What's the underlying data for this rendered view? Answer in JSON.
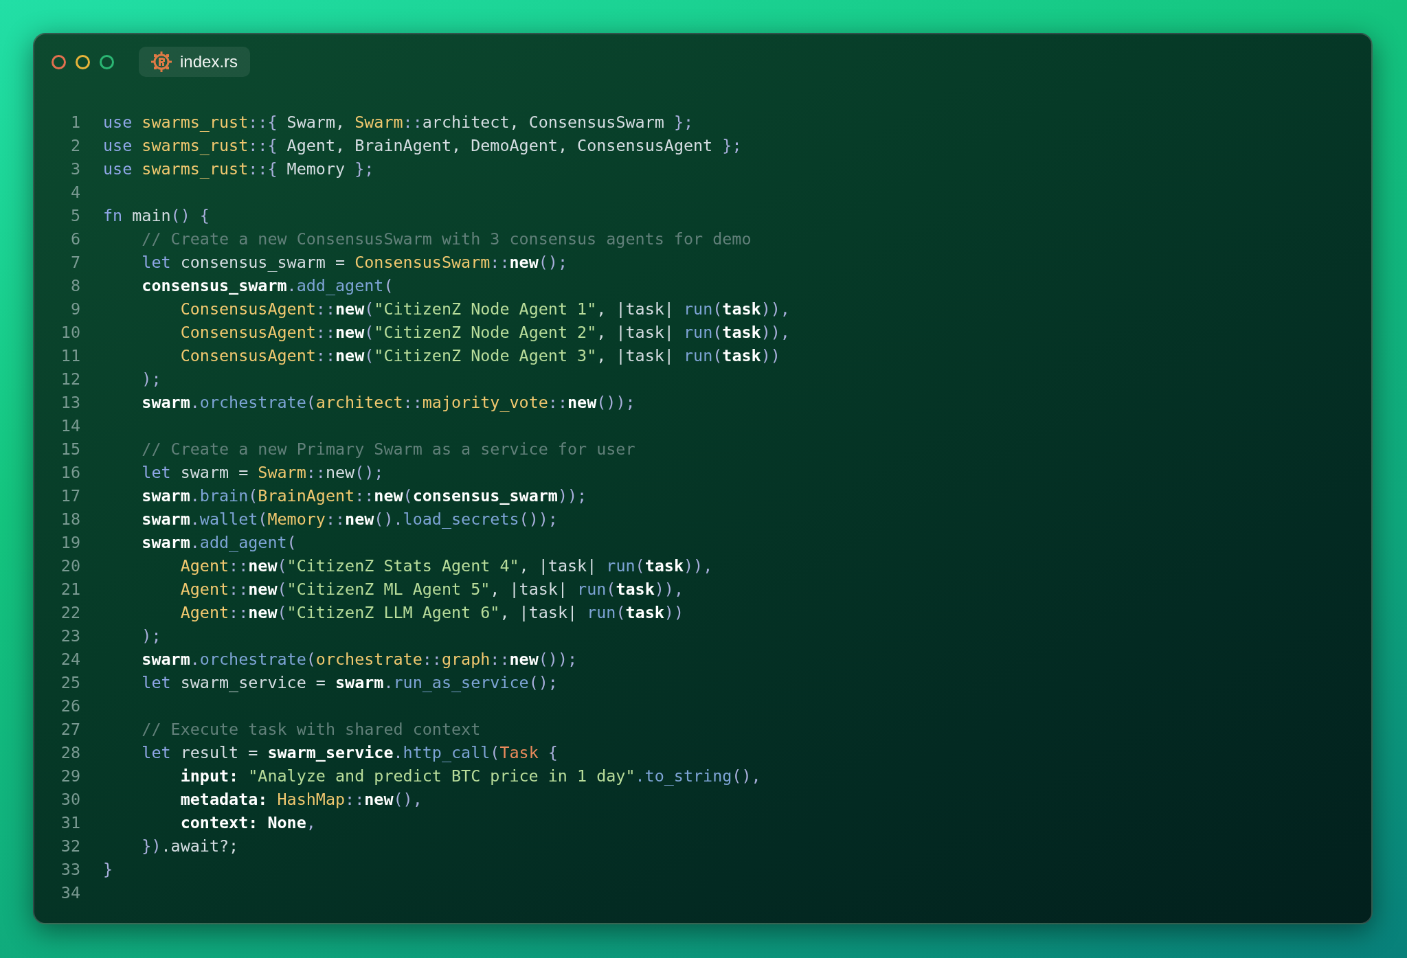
{
  "tab": {
    "title": "index.rs"
  },
  "lines": [
    {
      "number": "1",
      "tokens": [
        {
          "kind": "kw",
          "text": "use "
        },
        {
          "kind": "mod",
          "text": "swarms_rust"
        },
        {
          "kind": "punct",
          "text": "::{"
        },
        {
          "kind": "plain",
          "text": " Swarm, "
        },
        {
          "kind": "mod",
          "text": "Swarm"
        },
        {
          "kind": "punct",
          "text": "::"
        },
        {
          "kind": "plain",
          "text": "architect, ConsensusSwarm "
        },
        {
          "kind": "punct",
          "text": "};"
        }
      ]
    },
    {
      "number": "2",
      "tokens": [
        {
          "kind": "kw",
          "text": "use "
        },
        {
          "kind": "mod",
          "text": "swarms_rust"
        },
        {
          "kind": "punct",
          "text": "::{"
        },
        {
          "kind": "plain",
          "text": " Agent, BrainAgent, DemoAgent, ConsensusAgent "
        },
        {
          "kind": "punct",
          "text": "};"
        }
      ]
    },
    {
      "number": "3",
      "tokens": [
        {
          "kind": "kw",
          "text": "use "
        },
        {
          "kind": "mod",
          "text": "swarms_rust"
        },
        {
          "kind": "punct",
          "text": "::{"
        },
        {
          "kind": "plain",
          "text": " Memory "
        },
        {
          "kind": "punct",
          "text": "};"
        }
      ]
    },
    {
      "number": "4"
    },
    {
      "number": "5",
      "tokens": [
        {
          "kind": "kw",
          "text": "fn"
        },
        {
          "kind": "plain",
          "text": " main"
        },
        {
          "kind": "punct",
          "text": "() {"
        }
      ]
    },
    {
      "number": "6",
      "tokens": [
        {
          "kind": "comment",
          "text": "    // Create a new ConsensusSwarm with 3 consensus agents for demo"
        }
      ]
    },
    {
      "number": "7",
      "tokens": [
        {
          "kind": "kw",
          "text": "    let"
        },
        {
          "kind": "plain",
          "text": " consensus_swarm = "
        },
        {
          "kind": "mod",
          "text": "ConsensusSwarm"
        },
        {
          "kind": "punct",
          "text": "::"
        },
        {
          "kind": "var",
          "text": "new"
        },
        {
          "kind": "punct",
          "text": "();"
        }
      ]
    },
    {
      "number": "8",
      "tokens": [
        {
          "kind": "var",
          "text": "    consensus_swarm"
        },
        {
          "kind": "punct",
          "text": "."
        },
        {
          "kind": "method",
          "text": "add_agent"
        },
        {
          "kind": "punct",
          "text": "("
        }
      ]
    },
    {
      "number": "9",
      "tokens": [
        {
          "kind": "mod",
          "text": "        ConsensusAgent"
        },
        {
          "kind": "punct",
          "text": "::"
        },
        {
          "kind": "var",
          "text": "new"
        },
        {
          "kind": "punct",
          "text": "("
        },
        {
          "kind": "str",
          "text": "\"CitizenZ Node Agent 1\""
        },
        {
          "kind": "plain",
          "text": ", |task| "
        },
        {
          "kind": "method",
          "text": "run"
        },
        {
          "kind": "punct",
          "text": "("
        },
        {
          "kind": "var",
          "text": "task"
        },
        {
          "kind": "punct",
          "text": ")),"
        }
      ]
    },
    {
      "number": "10",
      "tokens": [
        {
          "kind": "mod",
          "text": "        ConsensusAgent"
        },
        {
          "kind": "punct",
          "text": "::"
        },
        {
          "kind": "var",
          "text": "new"
        },
        {
          "kind": "punct",
          "text": "("
        },
        {
          "kind": "str",
          "text": "\"CitizenZ Node Agent 2\""
        },
        {
          "kind": "plain",
          "text": ", |task| "
        },
        {
          "kind": "method",
          "text": "run"
        },
        {
          "kind": "punct",
          "text": "("
        },
        {
          "kind": "var",
          "text": "task"
        },
        {
          "kind": "punct",
          "text": ")),"
        }
      ]
    },
    {
      "number": "11",
      "tokens": [
        {
          "kind": "mod",
          "text": "        ConsensusAgent"
        },
        {
          "kind": "punct",
          "text": "::"
        },
        {
          "kind": "var",
          "text": "new"
        },
        {
          "kind": "punct",
          "text": "("
        },
        {
          "kind": "str",
          "text": "\"CitizenZ Node Agent 3\""
        },
        {
          "kind": "plain",
          "text": ", |task| "
        },
        {
          "kind": "method",
          "text": "run"
        },
        {
          "kind": "punct",
          "text": "("
        },
        {
          "kind": "var",
          "text": "task"
        },
        {
          "kind": "punct",
          "text": "))"
        }
      ]
    },
    {
      "number": "12",
      "tokens": [
        {
          "kind": "punct",
          "text": "    );"
        }
      ]
    },
    {
      "number": "13",
      "tokens": [
        {
          "kind": "var",
          "text": "    swarm"
        },
        {
          "kind": "punct",
          "text": "."
        },
        {
          "kind": "method",
          "text": "orchestrate"
        },
        {
          "kind": "punct",
          "text": "("
        },
        {
          "kind": "mod",
          "text": "architect"
        },
        {
          "kind": "punct",
          "text": "::"
        },
        {
          "kind": "mod",
          "text": "majority_vote"
        },
        {
          "kind": "punct",
          "text": "::"
        },
        {
          "kind": "var",
          "text": "new"
        },
        {
          "kind": "punct",
          "text": "());"
        }
      ]
    },
    {
      "number": "14"
    },
    {
      "number": "15",
      "tokens": [
        {
          "kind": "comment",
          "text": "    // Create a new Primary Swarm as a service for user"
        }
      ]
    },
    {
      "number": "16",
      "tokens": [
        {
          "kind": "kw",
          "text": "    let"
        },
        {
          "kind": "plain",
          "text": " swarm = "
        },
        {
          "kind": "mod",
          "text": "Swarm"
        },
        {
          "kind": "punct",
          "text": "::"
        },
        {
          "kind": "plain",
          "text": "new"
        },
        {
          "kind": "punct",
          "text": "();"
        }
      ]
    },
    {
      "number": "17",
      "tokens": [
        {
          "kind": "var",
          "text": "    swarm"
        },
        {
          "kind": "punct",
          "text": "."
        },
        {
          "kind": "method",
          "text": "brain"
        },
        {
          "kind": "punct",
          "text": "("
        },
        {
          "kind": "mod",
          "text": "BrainAgent"
        },
        {
          "kind": "punct",
          "text": "::"
        },
        {
          "kind": "var",
          "text": "new"
        },
        {
          "kind": "punct",
          "text": "("
        },
        {
          "kind": "var",
          "text": "consensus_swarm"
        },
        {
          "kind": "punct",
          "text": "));"
        }
      ]
    },
    {
      "number": "18",
      "tokens": [
        {
          "kind": "var",
          "text": "    swarm"
        },
        {
          "kind": "punct",
          "text": "."
        },
        {
          "kind": "method",
          "text": "wallet"
        },
        {
          "kind": "punct",
          "text": "("
        },
        {
          "kind": "mod",
          "text": "Memory"
        },
        {
          "kind": "punct",
          "text": "::"
        },
        {
          "kind": "var",
          "text": "new"
        },
        {
          "kind": "punct",
          "text": "()."
        },
        {
          "kind": "method",
          "text": "load_secrets"
        },
        {
          "kind": "punct",
          "text": "());"
        }
      ]
    },
    {
      "number": "19",
      "tokens": [
        {
          "kind": "var",
          "text": "    swarm"
        },
        {
          "kind": "punct",
          "text": "."
        },
        {
          "kind": "method",
          "text": "add_agent"
        },
        {
          "kind": "punct",
          "text": "("
        }
      ]
    },
    {
      "number": "20",
      "tokens": [
        {
          "kind": "mod",
          "text": "        Agent"
        },
        {
          "kind": "punct",
          "text": "::"
        },
        {
          "kind": "var",
          "text": "new"
        },
        {
          "kind": "punct",
          "text": "("
        },
        {
          "kind": "str",
          "text": "\"CitizenZ Stats Agent 4\""
        },
        {
          "kind": "plain",
          "text": ", |task| "
        },
        {
          "kind": "method",
          "text": "run"
        },
        {
          "kind": "punct",
          "text": "("
        },
        {
          "kind": "var",
          "text": "task"
        },
        {
          "kind": "punct",
          "text": ")),"
        }
      ]
    },
    {
      "number": "21",
      "tokens": [
        {
          "kind": "mod",
          "text": "        Agent"
        },
        {
          "kind": "punct",
          "text": "::"
        },
        {
          "kind": "var",
          "text": "new"
        },
        {
          "kind": "punct",
          "text": "("
        },
        {
          "kind": "str",
          "text": "\"CitizenZ ML Agent 5\""
        },
        {
          "kind": "plain",
          "text": ", |task| "
        },
        {
          "kind": "method",
          "text": "run"
        },
        {
          "kind": "punct",
          "text": "("
        },
        {
          "kind": "var",
          "text": "task"
        },
        {
          "kind": "punct",
          "text": ")),"
        }
      ]
    },
    {
      "number": "22",
      "tokens": [
        {
          "kind": "mod",
          "text": "        Agent"
        },
        {
          "kind": "punct",
          "text": "::"
        },
        {
          "kind": "var",
          "text": "new"
        },
        {
          "kind": "punct",
          "text": "("
        },
        {
          "kind": "str",
          "text": "\"CitizenZ LLM Agent 6\""
        },
        {
          "kind": "plain",
          "text": ", |task| "
        },
        {
          "kind": "method",
          "text": "run"
        },
        {
          "kind": "punct",
          "text": "("
        },
        {
          "kind": "var",
          "text": "task"
        },
        {
          "kind": "punct",
          "text": "))"
        }
      ]
    },
    {
      "number": "23",
      "tokens": [
        {
          "kind": "punct",
          "text": "    );"
        }
      ]
    },
    {
      "number": "24",
      "tokens": [
        {
          "kind": "var",
          "text": "    swarm"
        },
        {
          "kind": "punct",
          "text": "."
        },
        {
          "kind": "method",
          "text": "orchestrate"
        },
        {
          "kind": "punct",
          "text": "("
        },
        {
          "kind": "mod",
          "text": "orchestrate"
        },
        {
          "kind": "punct",
          "text": "::"
        },
        {
          "kind": "mod",
          "text": "graph"
        },
        {
          "kind": "punct",
          "text": "::"
        },
        {
          "kind": "var",
          "text": "new"
        },
        {
          "kind": "punct",
          "text": "());"
        }
      ]
    },
    {
      "number": "25",
      "tokens": [
        {
          "kind": "kw",
          "text": "    let"
        },
        {
          "kind": "plain",
          "text": " swarm_service = "
        },
        {
          "kind": "var",
          "text": "swarm"
        },
        {
          "kind": "punct",
          "text": "."
        },
        {
          "kind": "method",
          "text": "run_as_service"
        },
        {
          "kind": "punct",
          "text": "();"
        }
      ]
    },
    {
      "number": "26"
    },
    {
      "number": "27",
      "tokens": [
        {
          "kind": "comment",
          "text": "    // Execute task with shared context"
        }
      ]
    },
    {
      "number": "28",
      "tokens": [
        {
          "kind": "kw",
          "text": "    let"
        },
        {
          "kind": "plain",
          "text": " result = "
        },
        {
          "kind": "var",
          "text": "swarm_service"
        },
        {
          "kind": "punct",
          "text": "."
        },
        {
          "kind": "method",
          "text": "http_call"
        },
        {
          "kind": "punct",
          "text": "("
        },
        {
          "kind": "struct",
          "text": "Task"
        },
        {
          "kind": "punct",
          "text": " {"
        }
      ]
    },
    {
      "number": "29",
      "tokens": [
        {
          "kind": "var",
          "text": "        input: "
        },
        {
          "kind": "str",
          "text": "\"Analyze and predict BTC price in 1 day\""
        },
        {
          "kind": "method",
          "text": ".to_string"
        },
        {
          "kind": "punct",
          "text": "(),"
        }
      ]
    },
    {
      "number": "30",
      "tokens": [
        {
          "kind": "var",
          "text": "        metadata: "
        },
        {
          "kind": "mod",
          "text": "HashMap"
        },
        {
          "kind": "punct",
          "text": "::"
        },
        {
          "kind": "var",
          "text": "new"
        },
        {
          "kind": "punct",
          "text": "(),"
        }
      ]
    },
    {
      "number": "31",
      "tokens": [
        {
          "kind": "var",
          "text": "        context: None"
        },
        {
          "kind": "punct",
          "text": ","
        }
      ]
    },
    {
      "number": "32",
      "tokens": [
        {
          "kind": "punct",
          "text": "    })"
        },
        {
          "kind": "plain",
          "text": ".await?;"
        }
      ]
    },
    {
      "number": "33",
      "tokens": [
        {
          "kind": "punct",
          "text": "}"
        }
      ]
    },
    {
      "number": "34"
    }
  ]
}
